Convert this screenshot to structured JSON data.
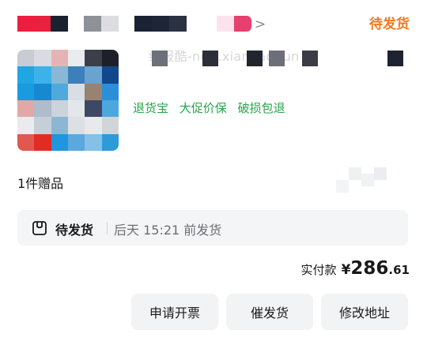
{
  "header": {
    "shop_name_blurred": true,
    "chevron": ">",
    "status": "待发货"
  },
  "watermark": "线报酷-new.xianbao.fun",
  "product": {
    "thumbnail_blurred": true,
    "services": [
      "退货宝",
      "大促价保",
      "破损包退"
    ]
  },
  "gift_text": "1件赠品",
  "shipping": {
    "icon": "package-icon",
    "title": "待发货",
    "time": "后天 15:21 前发货"
  },
  "payment": {
    "label": "实付款",
    "currency": "¥",
    "integer": "286",
    "decimal": ".61"
  },
  "buttons": {
    "invoice": "申请开票",
    "urge": "催发货",
    "address": "修改地址"
  },
  "colors": {
    "status": "#f07a1f",
    "service": "#2aa34a"
  }
}
